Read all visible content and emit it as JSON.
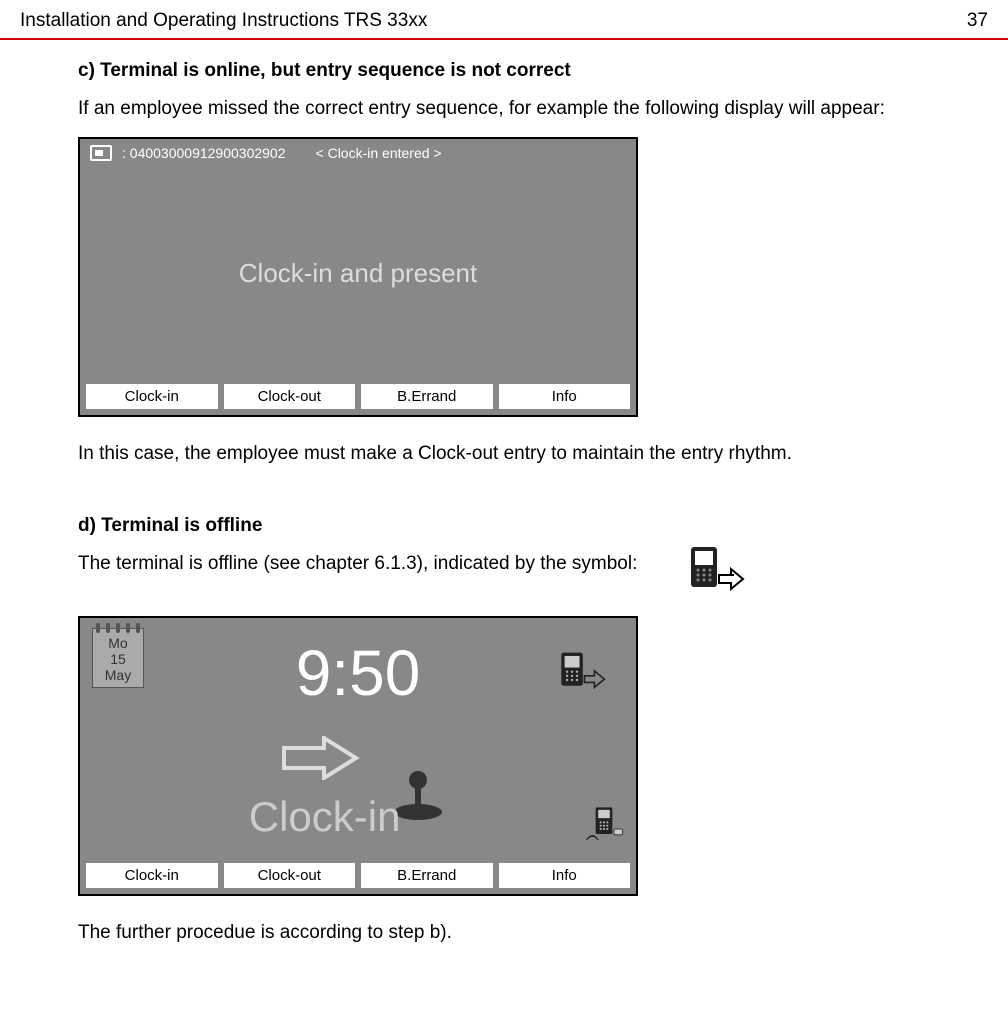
{
  "header": {
    "title": "Installation and Operating Instructions TRS 33xx",
    "page": "37"
  },
  "sectionC": {
    "heading": "c) Terminal is online, but entry sequence is not correct",
    "intro": "If an employee missed the correct entry sequence, for example the following display will appear:",
    "screen": {
      "card_id": ": 04003000912900302902",
      "status": "< Clock-in entered >",
      "main_text": "Clock-in and present",
      "buttons": [
        "Clock-in",
        "Clock-out",
        "B.Errand",
        "Info"
      ]
    },
    "note": "In this case, the employee must make a Clock-out entry to maintain the entry rhythm."
  },
  "sectionD": {
    "heading": "d) Terminal is offline",
    "intro": "The terminal is offline (see chapter 6.1.3), indicated by the symbol:",
    "screen": {
      "date": {
        "dow": "Mo",
        "day": "15",
        "month": "May"
      },
      "time": "9:50",
      "action": "Clock-in",
      "buttons": [
        "Clock-in",
        "Clock-out",
        "B.Errand",
        "Info"
      ]
    },
    "outro": "The further procedue is according to step b)."
  }
}
